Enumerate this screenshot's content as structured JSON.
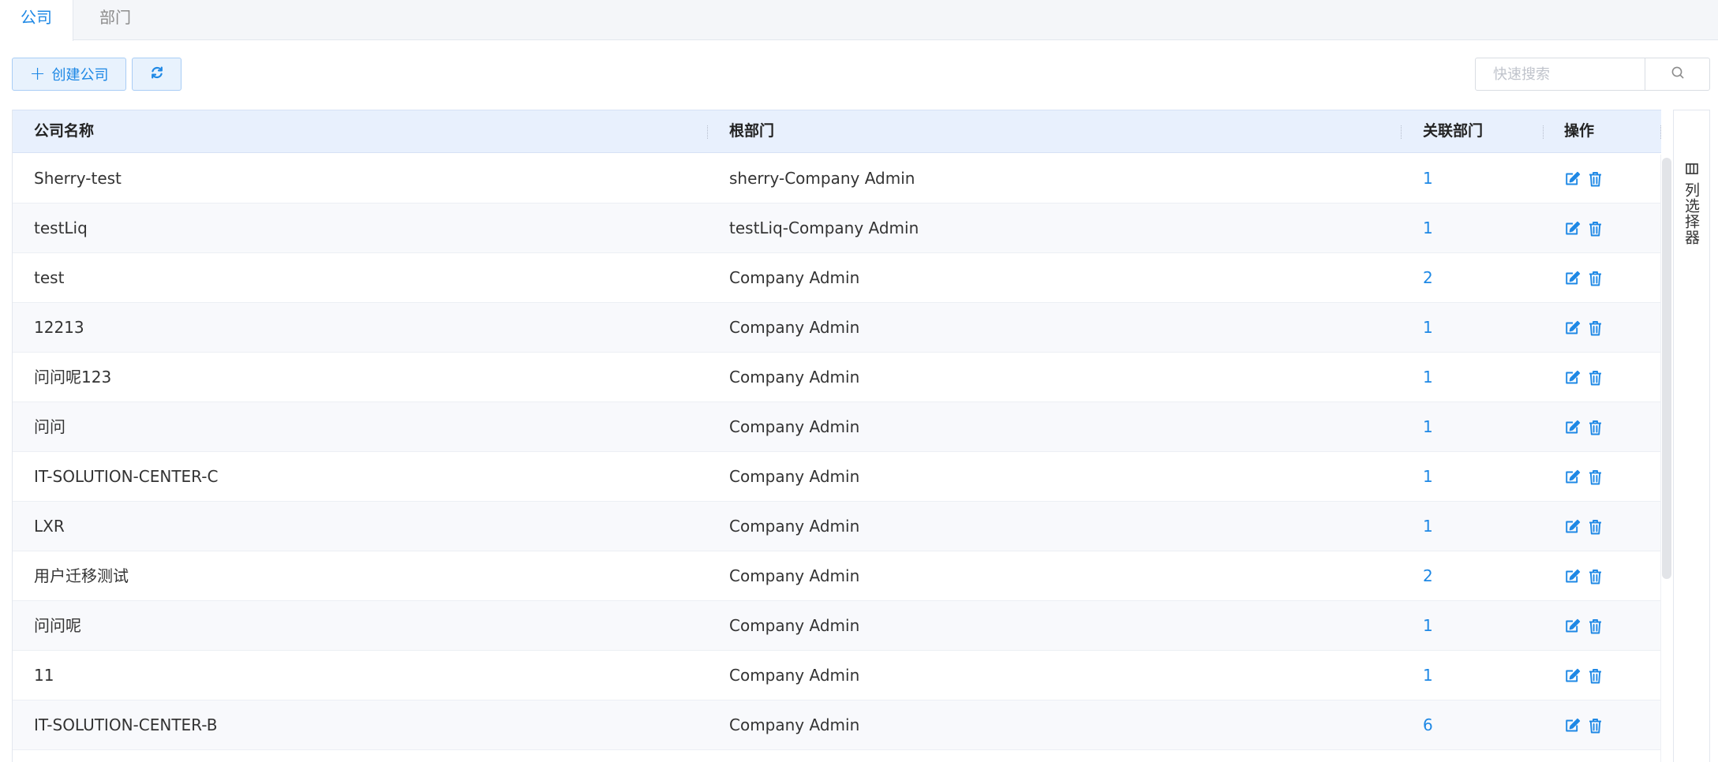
{
  "tabs": [
    {
      "label": "公司",
      "active": true
    },
    {
      "label": "部门",
      "active": false
    }
  ],
  "toolbar": {
    "create_label": "创建公司",
    "plus_glyph": "+",
    "refresh_icon": "refresh-icon",
    "search_placeholder": "快速搜索",
    "search_icon": "search-icon"
  },
  "table": {
    "columns": [
      "公司名称",
      "根部门",
      "关联部门",
      "操作"
    ],
    "rows": [
      {
        "name": "Sherry-test",
        "root": "sherry-Company Admin",
        "count": "1"
      },
      {
        "name": "testLiq",
        "root": "testLiq-Company Admin",
        "count": "1"
      },
      {
        "name": "test",
        "root": "Company Admin",
        "count": "2"
      },
      {
        "name": "12213",
        "root": "Company Admin",
        "count": "1"
      },
      {
        "name": "问问呢123",
        "root": "Company Admin",
        "count": "1"
      },
      {
        "name": "问问",
        "root": "Company Admin",
        "count": "1"
      },
      {
        "name": "IT-SOLUTION-CENTER-C",
        "root": "Company Admin",
        "count": "1"
      },
      {
        "name": "LXR",
        "root": "Company Admin",
        "count": "1"
      },
      {
        "name": "用户迁移测试",
        "root": "Company Admin",
        "count": "2"
      },
      {
        "name": "问问呢",
        "root": "Company Admin",
        "count": "1"
      },
      {
        "name": "11",
        "root": "Company Admin",
        "count": "1"
      },
      {
        "name": "IT-SOLUTION-CENTER-B",
        "root": "Company Admin",
        "count": "6"
      }
    ],
    "row_actions": [
      "edit-icon",
      "delete-icon"
    ]
  },
  "side_panel": {
    "label": "列选择器",
    "icon": "columns-icon"
  },
  "colors": {
    "accent": "#1e88e5",
    "header_bg": "#e8f0fd",
    "stripe_bg": "#f8f9fc",
    "tabbar_bg": "#f4f6f9"
  }
}
